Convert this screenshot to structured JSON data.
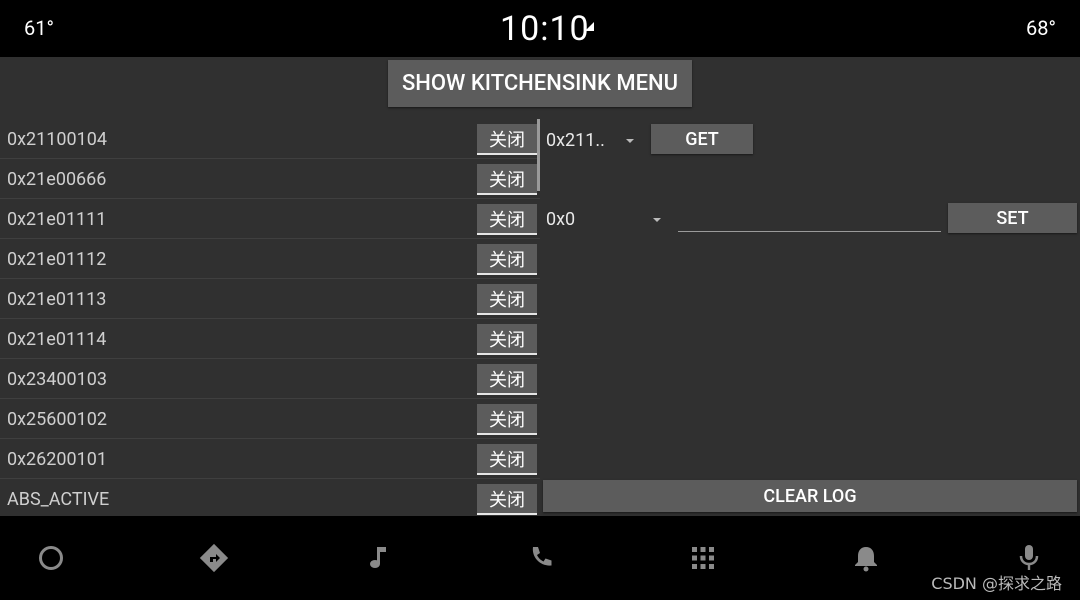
{
  "status_bar": {
    "temp_left": "61°",
    "clock": "10:10",
    "temp_right": "68°"
  },
  "kitchensink_button": "SHOW KITCHENSINK MENU",
  "properties": [
    {
      "id": "0x21100104",
      "toggle": "关闭"
    },
    {
      "id": "0x21e00666",
      "toggle": "关闭"
    },
    {
      "id": "0x21e01111",
      "toggle": "关闭"
    },
    {
      "id": "0x21e01112",
      "toggle": "关闭"
    },
    {
      "id": "0x21e01113",
      "toggle": "关闭"
    },
    {
      "id": "0x21e01114",
      "toggle": "关闭"
    },
    {
      "id": "0x23400103",
      "toggle": "关闭"
    },
    {
      "id": "0x25600102",
      "toggle": "关闭"
    },
    {
      "id": "0x26200101",
      "toggle": "关闭"
    },
    {
      "id": "ABS_ACTIVE",
      "toggle": "关闭"
    }
  ],
  "get_panel": {
    "property_dropdown": "0x211..",
    "get_button": "GET"
  },
  "set_panel": {
    "area_dropdown": "0x0",
    "value_input": "",
    "set_button": "SET"
  },
  "clear_log_button": "CLEAR LOG",
  "nav_icons": [
    "home-icon",
    "navigation-icon",
    "music-icon",
    "phone-icon",
    "apps-grid-icon",
    "notifications-icon",
    "microphone-icon"
  ],
  "watermark": "CSDN @探求之路",
  "colors": {
    "background": "#303030",
    "button": "#5c5c5c",
    "bars": "#000000"
  }
}
